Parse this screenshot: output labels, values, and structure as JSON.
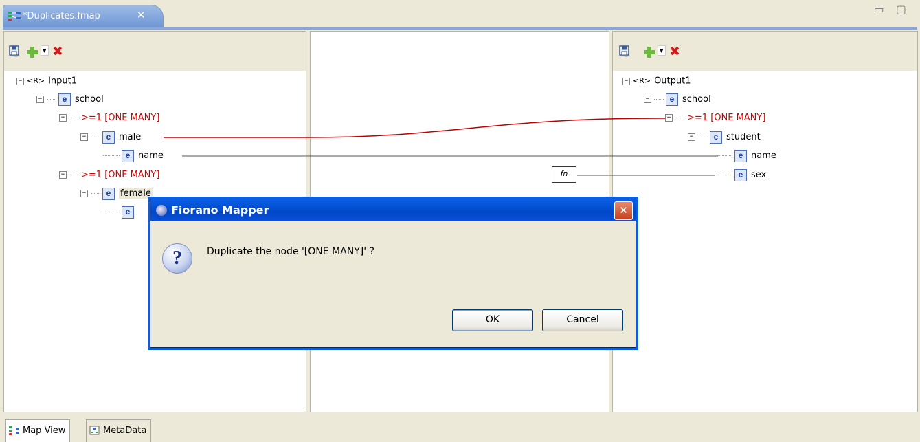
{
  "editor": {
    "tab_title": "*Duplicates.fmap",
    "close_glyph": "✕",
    "window_controls": "▭ ▢"
  },
  "toolbar": {
    "save_icon": "floppy-disk",
    "add_icon": "green-plus",
    "dropdown_glyph": "▾",
    "delete_glyph": "✖"
  },
  "input_tree": {
    "root": "Input1",
    "root_badge": "<R>",
    "school": "school",
    "group1": ">=1 [ONE MANY]",
    "male": "male",
    "name": "name",
    "group2": ">=1 [ONE MANY]",
    "female": "female",
    "element_badge": "e"
  },
  "output_tree": {
    "root": "Output1",
    "root_badge": "<R>",
    "school": "school",
    "group1": ">=1 [ONE MANY]",
    "student": "student",
    "name": "name",
    "sex": "sex",
    "element_badge": "e"
  },
  "mapping": {
    "function_box_label": "fn",
    "line_colors": {
      "mapped": "#c00000",
      "plain": "#555555"
    }
  },
  "dialog": {
    "title": "Fiorano Mapper",
    "message": "Duplicate the node  '[ONE MANY]' ?",
    "ok_label": "OK",
    "cancel_label": "Cancel",
    "close_glyph": "✕",
    "icon_glyph": "?"
  },
  "bottom_tabs": [
    {
      "label": "Map View"
    },
    {
      "label": "MetaData"
    }
  ]
}
